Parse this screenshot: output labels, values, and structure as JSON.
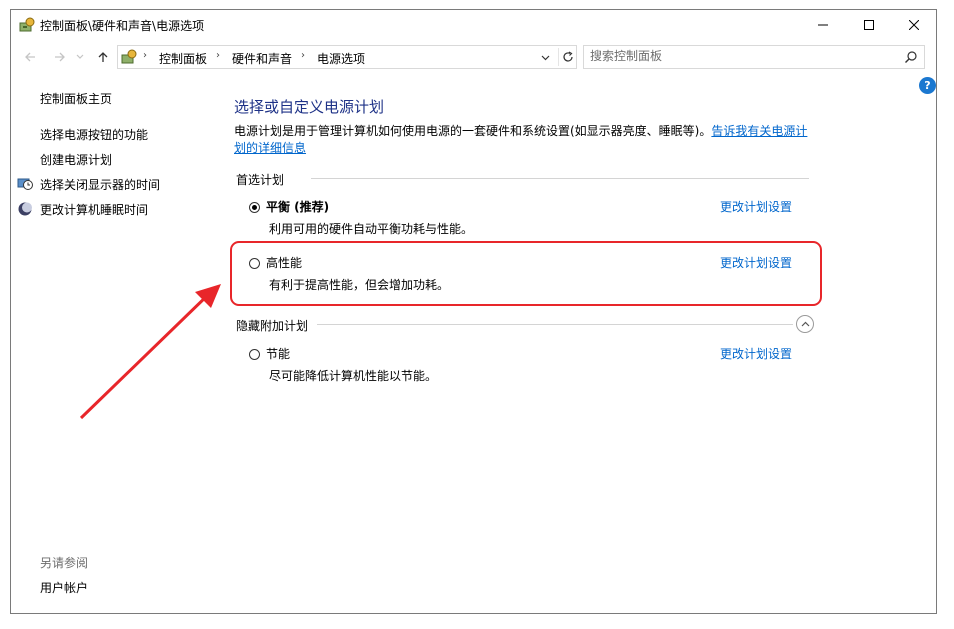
{
  "window": {
    "title": "控制面板\\硬件和声音\\电源选项",
    "controls": {
      "minimize": "minimize-icon",
      "maximize": "maximize-icon",
      "close": "close-icon"
    }
  },
  "address_bar": {
    "breadcrumb": [
      "控制面板",
      "硬件和声音",
      "电源选项"
    ]
  },
  "search": {
    "placeholder": "搜索控制面板"
  },
  "help_label": "?",
  "sidebar": {
    "home": "控制面板主页",
    "links": [
      {
        "label": "选择电源按钮的功能",
        "icon": ""
      },
      {
        "label": "创建电源计划",
        "icon": ""
      },
      {
        "label": "选择关闭显示器的时间",
        "icon": "monitor-clock-icon"
      },
      {
        "label": "更改计算机睡眠时间",
        "icon": "moon-icon"
      }
    ],
    "see_also": "另请参阅",
    "user_accounts": "用户帐户"
  },
  "main": {
    "title": "选择或自定义电源计划",
    "description": "电源计划是用于管理计算机如何使用电源的一套硬件和系统设置(如显示器亮度、睡眠等)。",
    "description_link": "告诉我有关电源计划的详细信息",
    "preferred_label": "首选计划",
    "hidden_label": "隐藏附加计划",
    "plans": [
      {
        "name": "平衡 (推荐)",
        "desc": "利用可用的硬件自动平衡功耗与性能。",
        "link": "更改计划设置",
        "selected": true
      },
      {
        "name": "高性能",
        "desc": "有利于提高性能，但会增加功耗。",
        "link": "更改计划设置",
        "selected": false
      },
      {
        "name": "节能",
        "desc": "尽可能降低计算机性能以节能。",
        "link": "更改计划设置",
        "selected": false
      }
    ]
  },
  "annotation": {
    "highlight_color": "#e8262a",
    "arrow_color": "#e8262a"
  },
  "colors": {
    "title_blue": "#1e3287",
    "link_blue": "#0066cc",
    "help_blue": "#1b78d0"
  }
}
